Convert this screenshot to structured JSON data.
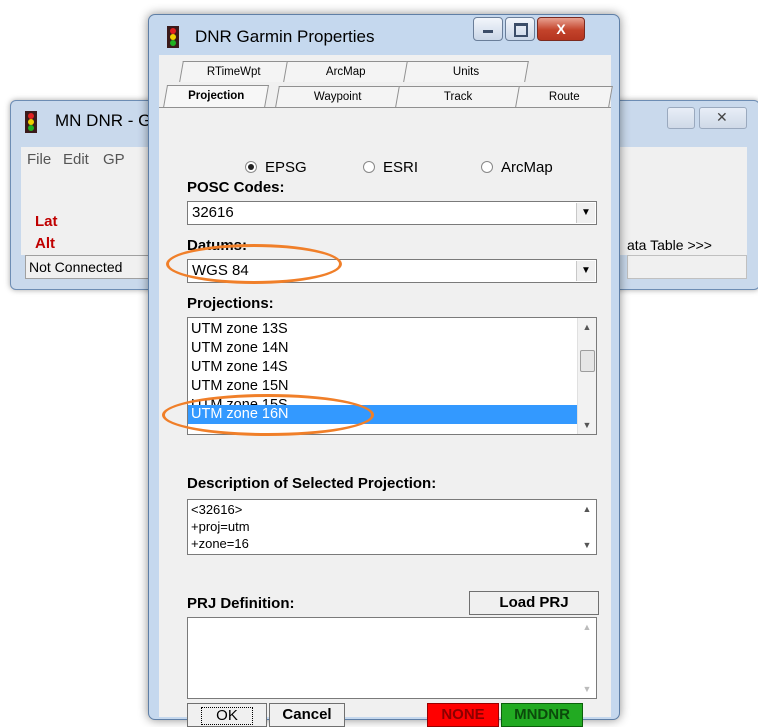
{
  "background_window": {
    "title": "MN DNR - G",
    "menu": [
      "File",
      "Edit",
      "GP"
    ],
    "lat_label": "Lat",
    "alt_label": "Alt",
    "status": "Not Connected",
    "data_table_label": "ata Table >>>"
  },
  "dialog": {
    "title": "DNR Garmin Properties",
    "close_glyph": "X",
    "tabs_row_top": [
      "RTimeWpt",
      "ArcMap",
      "Units"
    ],
    "tabs_row_bottom": [
      "Projection",
      "Waypoint",
      "Track",
      "Route"
    ],
    "active_tab": "Projection",
    "radio_options": [
      "EPSG",
      "ESRI",
      "ArcMap"
    ],
    "radio_selected": "EPSG",
    "posc_label": "POSC Codes:",
    "posc_value": "32616",
    "datums_label": "Datums:",
    "datum_value": "WGS 84",
    "projections_label": "Projections:",
    "projections": [
      "UTM zone 13S",
      "UTM zone 14N",
      "UTM zone 14S",
      "UTM zone 15N",
      "UTM zone 15S",
      "UTM zone 16N"
    ],
    "projection_selected": "UTM zone 16N",
    "description_label": "Description of Selected Projection:",
    "description_lines": [
      "<32616>",
      "+proj=utm",
      "+zone=16"
    ],
    "prj_label": "PRJ Definition:",
    "load_prj_label": "Load PRJ",
    "ok_label": "OK",
    "cancel_label": "Cancel",
    "none_label": "NONE",
    "mndnr_label": "MNDNR",
    "colors": {
      "none_bg": "#ff0000",
      "mndnr_bg": "#22aa22",
      "highlight": "#f07f29",
      "selection": "#3399ff"
    }
  }
}
